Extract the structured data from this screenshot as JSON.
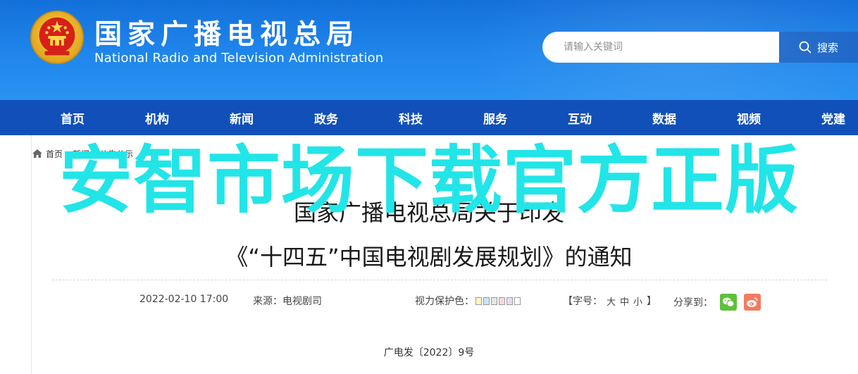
{
  "header": {
    "title_cn": "国家广播电视总局",
    "title_en": "National Radio and Television Administration",
    "colors": {
      "header_blue": "#1f86ec",
      "nav_blue": "#1150b8",
      "search_button": "#1c66c8"
    }
  },
  "search": {
    "placeholder": "请输入关键词",
    "button_label": "搜索",
    "icon": "search-icon"
  },
  "nav": {
    "items": [
      {
        "label": "首页"
      },
      {
        "label": "机构"
      },
      {
        "label": "新闻"
      },
      {
        "label": "政务"
      },
      {
        "label": "科技"
      },
      {
        "label": "服务"
      },
      {
        "label": "互动"
      },
      {
        "label": "数据"
      },
      {
        "label": "视频"
      },
      {
        "label": "党建"
      }
    ]
  },
  "breadcrumb": {
    "items": [
      "首页",
      "新闻",
      "公告公示"
    ],
    "separator": ">",
    "icon": "home-icon"
  },
  "overlay": {
    "watermark": "安智市场下载官方正版",
    "color": "#22e5e8"
  },
  "article": {
    "title_line1": "国家广播电视总局关于印发",
    "title_line2": "《“十四五”中国电视剧发展规划》的通知",
    "date": "2022-02-10 17:00",
    "source": "来源：电视剧司",
    "eye_protect_label": "视力保护色：",
    "eye_colors": [
      "#fff5c0",
      "#c8e6f8",
      "#e6e6e6",
      "#f7d9e3",
      "#ead9f5",
      "#ffffff"
    ],
    "font_label": "【字号：",
    "font_large": "大",
    "font_medium": "中",
    "font_small": "小",
    "font_close": "】",
    "share_label": "分享到：",
    "share_colors": {
      "wechat": "#5ec13a",
      "weibo": "#f47a60"
    },
    "doc_number": "广电发〔2022〕9号"
  }
}
